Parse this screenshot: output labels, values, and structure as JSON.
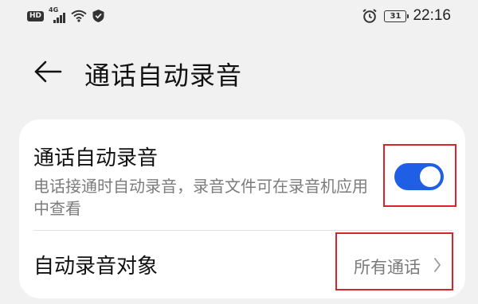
{
  "status_bar": {
    "hd": "HD",
    "network": "4G",
    "battery": "31",
    "time": "22:16",
    "icons": [
      "hd-icon",
      "signal-icon",
      "wifi-icon",
      "shield-icon",
      "alarm-icon",
      "battery-icon"
    ]
  },
  "header": {
    "back_icon": "arrow-left-icon",
    "title": "通话自动录音"
  },
  "settings": {
    "auto_record": {
      "title": "通话自动录音",
      "description": "电话接通时自动录音，录音文件可在录音机应用中查看",
      "enabled": true
    },
    "record_target": {
      "label": "自动录音对象",
      "value": "所有通话",
      "chevron_icon": "chevron-right-icon"
    }
  },
  "colors": {
    "accent": "#1e5fe6",
    "highlight": "#d9242b",
    "background": "#f1f1f1",
    "card": "#ffffff",
    "secondary_text": "#7c7c7c"
  }
}
